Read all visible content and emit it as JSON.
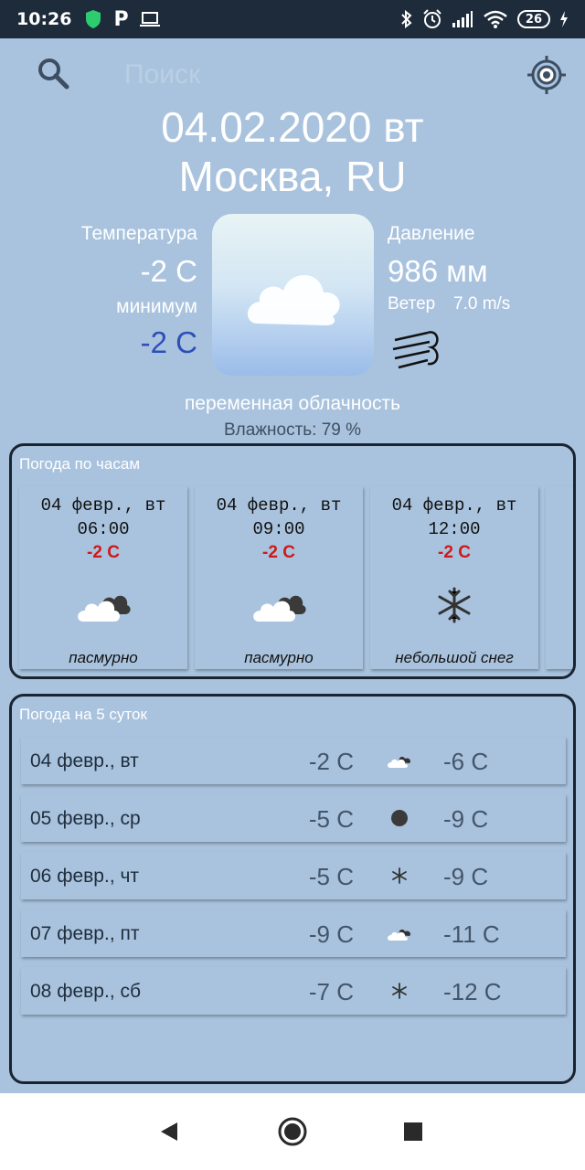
{
  "status_bar": {
    "time": "10:26",
    "battery": "26"
  },
  "search": {
    "placeholder": "Поиск"
  },
  "current": {
    "date": "04.02.2020 вт",
    "city": "Москва, RU",
    "temp_label": "Температура",
    "temp_value": "-2 C",
    "min_label": "минимум",
    "min_value": "-2 C",
    "pressure_label": "Давление",
    "pressure_value": "986 мм",
    "wind_label": "Ветер",
    "wind_value": "7.0 m/s",
    "description": "переменная облачность",
    "humidity": "Влажность: 79 %",
    "icon": "cloud-icon"
  },
  "hourly": {
    "title": "Погода по часам",
    "items": [
      {
        "date": "04 февр., вт",
        "time": "06:00",
        "temp": "-2 C",
        "desc": "пасмурно",
        "icon": "overcast-cloud-icon"
      },
      {
        "date": "04 февр., вт",
        "time": "09:00",
        "temp": "-2 C",
        "desc": "пасмурно",
        "icon": "overcast-cloud-icon"
      },
      {
        "date": "04 февр., вт",
        "time": "12:00",
        "temp": "-2 C",
        "desc": "небольшой снег",
        "icon": "snowflake-icon"
      }
    ]
  },
  "daily": {
    "title": "Погода на 5 суток",
    "items": [
      {
        "date": "04 февр., вт",
        "max": "-2 C",
        "min": "-6 C",
        "icon": "partly-cloudy-icon"
      },
      {
        "date": "05 февр., ср",
        "max": "-5 C",
        "min": "-9 C",
        "icon": "dark-circle-icon"
      },
      {
        "date": "06 февр., чт",
        "max": "-5 C",
        "min": "-9 C",
        "icon": "snowflake-icon"
      },
      {
        "date": "07 февр., пт",
        "max": "-9 C",
        "min": "-11 C",
        "icon": "partly-cloudy-icon"
      },
      {
        "date": "08 февр., сб",
        "max": "-7 C",
        "min": "-12 C",
        "icon": "snowflake-icon"
      }
    ]
  },
  "colors": {
    "background": "#a9c3de",
    "accent_blue": "#2f4fb8",
    "temp_red": "#d01919",
    "panel_border": "#1a2330"
  }
}
